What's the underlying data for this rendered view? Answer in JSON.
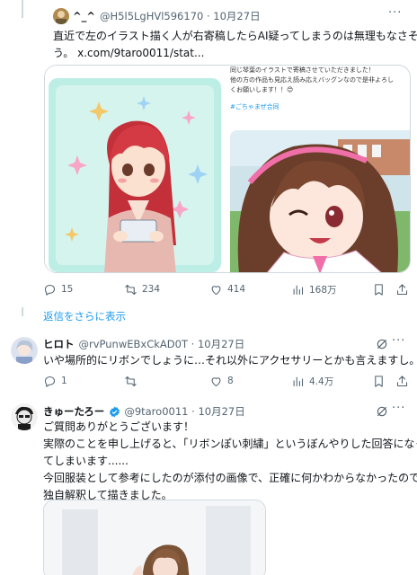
{
  "tweet1": {
    "display_name": "^_^",
    "handle": "@H5l5LgHVl596170",
    "date": "10月27日",
    "text_line1": "直近で左のイラスト描く人が右寄稿したらAI疑ってしまうのは無理もなさそ",
    "text_line2": "う。 x.com/9taro0011/stat...",
    "card_caption_line1": "同じ琴葉のイラストで寄稿させていただきました！",
    "card_caption_line2": "他の方の作品も見応え読み応えバッグンなので是非よろし",
    "card_caption_line3": "くお願いします！！😊",
    "card_hashtag": "#ごちゃまぜ合同",
    "stats": {
      "replies": "15",
      "reposts": "234",
      "likes": "414",
      "views": "168万"
    }
  },
  "show_more_replies": "返信をさらに表示",
  "reply1": {
    "display_name": "ヒロト",
    "handle": "@rvPunwEBxCkAD0T",
    "date": "10月27日",
    "text": "いや場所的にリボンでしょうに…それ以外にアクセサリーとかも言えますし。",
    "stats": {
      "replies": "1",
      "reposts": "",
      "likes": "8",
      "views": "4.4万"
    }
  },
  "reply2": {
    "display_name": "きゅーたろー",
    "handle": "@9taro0011",
    "date": "10月27日",
    "lines": [
      "ご質問ありがとうございます！",
      "実際のことを申し上げると、「リボンぽい刺繍」というぼんやりした回答になっ",
      "てしまいます......",
      "今回服装として参考にしたのが添付の画像で、正確に何かわからなかったので、",
      "独自解釈して描きました。"
    ]
  },
  "icons": {
    "reply": "reply-icon",
    "repost": "repost-icon",
    "like": "heart-icon",
    "views": "views-icon",
    "bookmark": "bookmark-icon",
    "share": "share-icon",
    "grok": "grok-icon",
    "more": "more-icon",
    "verified": "verified-badge-icon"
  },
  "colors": {
    "link": "#1d9bf0",
    "secondary": "#536471",
    "border": "#cfd9de",
    "verified": "#1d9bf0"
  }
}
